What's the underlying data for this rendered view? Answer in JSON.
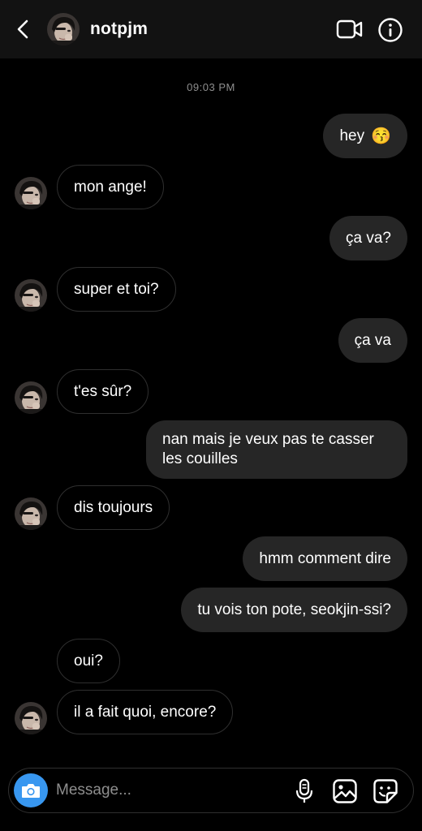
{
  "header": {
    "username": "notpjm",
    "back_icon": "chevron-left-icon",
    "video_icon": "video-camera-icon",
    "info_icon": "info-icon"
  },
  "conversation": {
    "timestamp": "09:03 PM",
    "messages": [
      {
        "sender": "me",
        "text": "hey",
        "emoji": "😚"
      },
      {
        "sender": "them",
        "text": "mon ange!"
      },
      {
        "sender": "me",
        "text": "ça va?"
      },
      {
        "sender": "them",
        "text": "super et toi?"
      },
      {
        "sender": "me",
        "text": "ça va"
      },
      {
        "sender": "them",
        "text": "t'es sûr?"
      },
      {
        "sender": "me",
        "text": "nan mais je veux pas te casser les couilles"
      },
      {
        "sender": "them",
        "text": "dis toujours"
      },
      {
        "sender": "me",
        "text": "hmm comment dire"
      },
      {
        "sender": "me",
        "text": "tu vois ton pote, seokjin-ssi?"
      },
      {
        "sender": "them",
        "text": "oui?"
      },
      {
        "sender": "them",
        "text": "il a fait quoi, encore?"
      }
    ]
  },
  "composer": {
    "placeholder": "Message...",
    "camera_icon": "camera-icon",
    "mic_icon": "microphone-icon",
    "gallery_icon": "gallery-icon",
    "sticker_icon": "sticker-icon",
    "camera_color": "#3897f0"
  },
  "colors": {
    "background": "#000000",
    "header": "#121212",
    "bubble_out": "#262626",
    "bubble_border": "#2f2f2f",
    "muted_text": "#8e8e8e"
  }
}
